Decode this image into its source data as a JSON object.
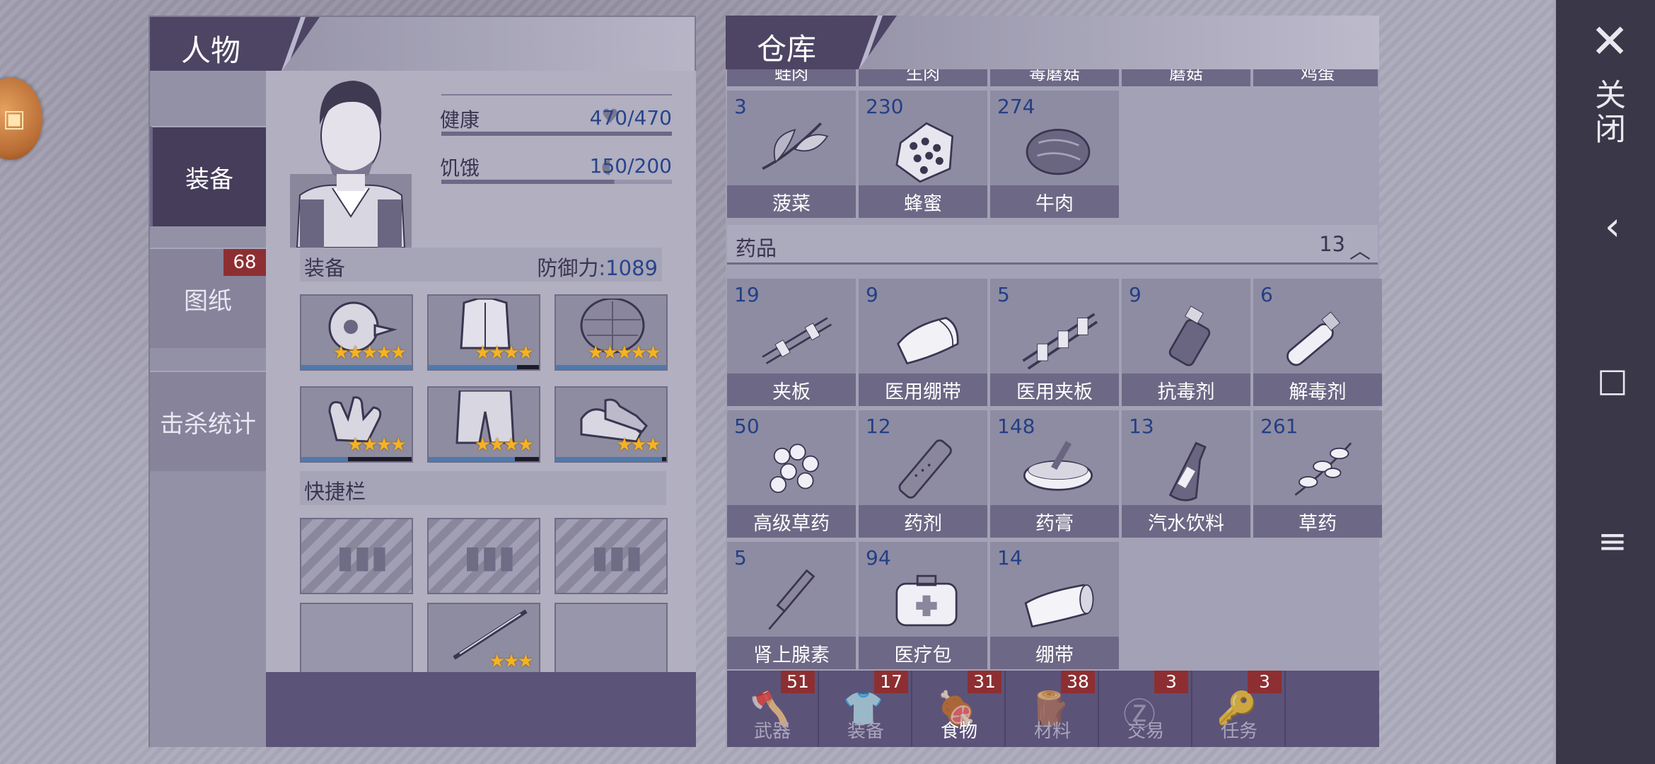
{
  "character": {
    "title": "人物",
    "side_tabs": [
      {
        "label": "装备",
        "active": true
      },
      {
        "label": "图纸",
        "badge": "68"
      },
      {
        "label": "击杀统计"
      }
    ],
    "stats": {
      "health_label": "健康",
      "health_value": "470/470",
      "hunger_label": "饥饿",
      "hunger_value": "150/200"
    },
    "equipment_section": "装备",
    "defense_label": "防御力",
    "defense_value": ":1089",
    "equipment": [
      {
        "icon": "bird-helmet-icon",
        "stars": "★★★★★",
        "durability": 1.0
      },
      {
        "icon": "armor-vest-icon",
        "stars": "★★★★",
        "durability": 0.8
      },
      {
        "icon": "turtle-shell-icon",
        "stars": "★★★★★",
        "durability": 1.0
      },
      {
        "icon": "gloves-icon",
        "stars": "★★★★",
        "durability": 0.42
      },
      {
        "icon": "pants-icon",
        "stars": "★★★★",
        "durability": 0.78
      },
      {
        "icon": "shoes-icon",
        "stars": "★★★",
        "durability": 0.96
      }
    ],
    "quickbar_section": "快捷栏",
    "quickbar": [
      {
        "state": "locked"
      },
      {
        "state": "locked"
      },
      {
        "state": "locked"
      },
      {
        "state": "empty"
      },
      {
        "state": "item",
        "icon": "syringe-pen-icon",
        "stars": "★★★",
        "durability": 1.0
      },
      {
        "state": "empty"
      }
    ]
  },
  "warehouse": {
    "title": "仓库",
    "top_partial_labels": [
      "蛙肉",
      "生肉",
      "毒蘑菇",
      "蘑菇",
      "鸡蛋"
    ],
    "food_items": [
      {
        "count": "3",
        "name": "菠菜",
        "icon": "spinach-icon"
      },
      {
        "count": "230",
        "name": "蜂蜜",
        "icon": "honeycomb-icon"
      },
      {
        "count": "274",
        "name": "牛肉",
        "icon": "beef-icon"
      }
    ],
    "category": {
      "label": "药品",
      "count": "13"
    },
    "medicine_items": [
      {
        "count": "19",
        "name": "夹板",
        "icon": "splint-icon"
      },
      {
        "count": "9",
        "name": "医用绷带",
        "icon": "medical-bandage-icon"
      },
      {
        "count": "5",
        "name": "医用夹板",
        "icon": "medical-splint-icon"
      },
      {
        "count": "9",
        "name": "抗毒剂",
        "icon": "antitoxin-icon"
      },
      {
        "count": "6",
        "name": "解毒剂",
        "icon": "antidote-icon"
      },
      {
        "count": "50",
        "name": "高级草药",
        "icon": "advanced-herb-icon"
      },
      {
        "count": "12",
        "name": "药剂",
        "icon": "potion-icon"
      },
      {
        "count": "148",
        "name": "药膏",
        "icon": "ointment-icon"
      },
      {
        "count": "13",
        "name": "汽水饮料",
        "icon": "soda-icon"
      },
      {
        "count": "261",
        "name": "草药",
        "icon": "herb-icon"
      },
      {
        "count": "5",
        "name": "肾上腺素",
        "icon": "adrenaline-icon"
      },
      {
        "count": "94",
        "name": "医疗包",
        "icon": "medkit-icon"
      },
      {
        "count": "14",
        "name": "绷带",
        "icon": "bandage-icon"
      }
    ],
    "bottom_tabs": [
      {
        "label": "武器",
        "badge": "51",
        "icon": "axe-icon",
        "active": false
      },
      {
        "label": "装备",
        "badge": "17",
        "icon": "shirt-icon",
        "active": false
      },
      {
        "label": "食物",
        "badge": "31",
        "icon": "meat-icon",
        "active": true
      },
      {
        "label": "材料",
        "badge": "38",
        "icon": "log-icon",
        "active": false
      },
      {
        "label": "交易",
        "badge": "3",
        "icon": "coin-icon",
        "active": false
      },
      {
        "label": "任务",
        "badge": "3",
        "icon": "key-icon",
        "active": false
      }
    ]
  },
  "system": {
    "close_label": "关闭",
    "close_icon": "✕",
    "back_icon": "‹",
    "home_icon": "□",
    "menu_icon": "≡"
  }
}
